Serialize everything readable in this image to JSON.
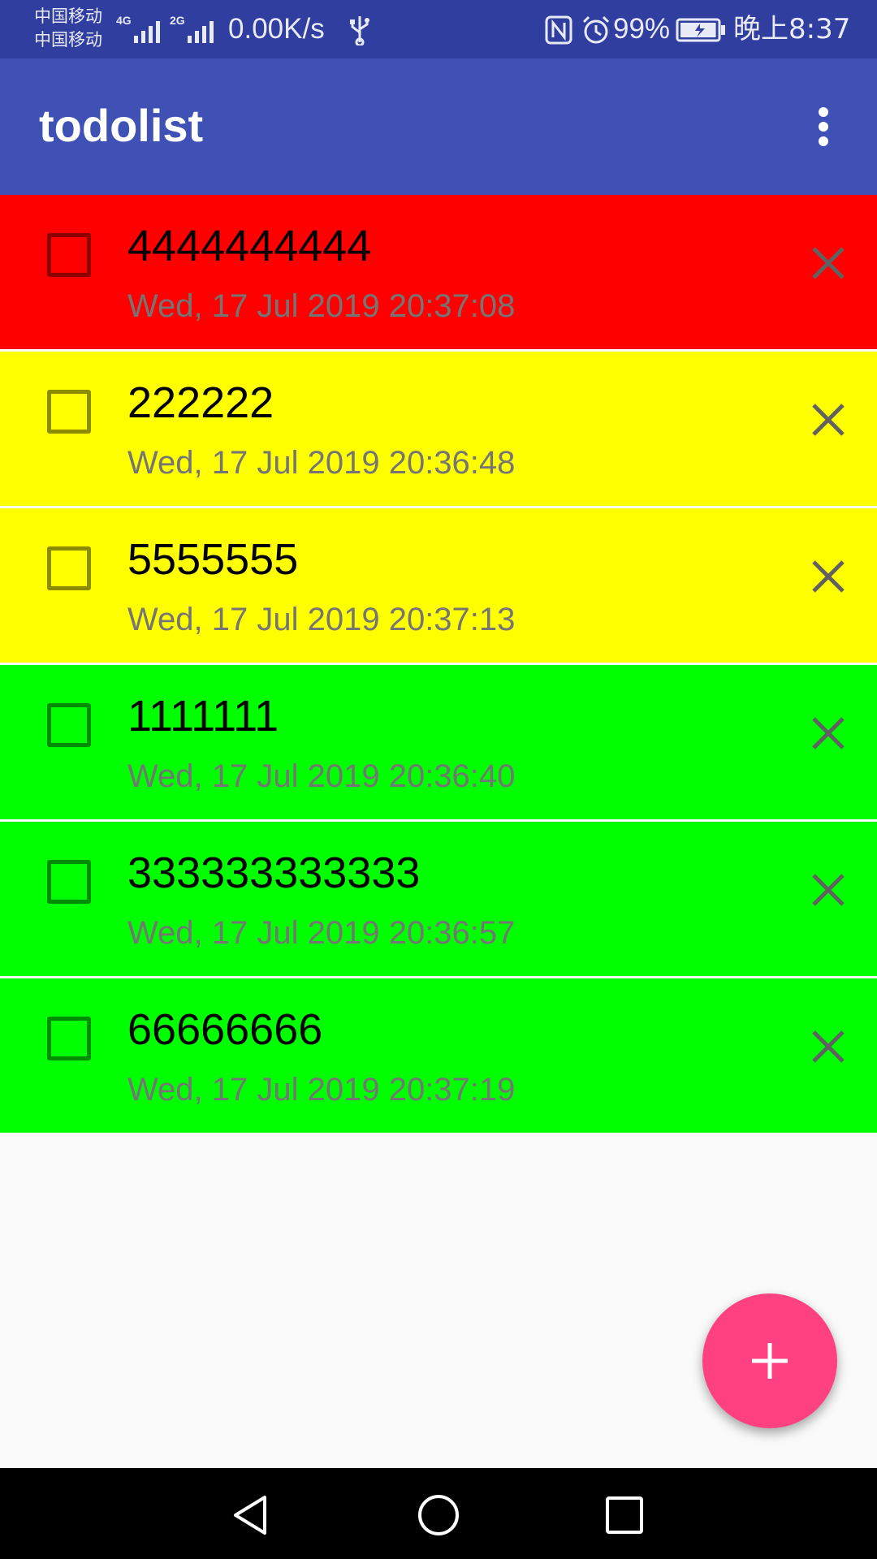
{
  "status_bar": {
    "carrier_line1": "中国移动",
    "carrier_line2": "中国移动",
    "sim1_network": "4G",
    "sim2_network": "2G",
    "net_speed": "0.00K/s",
    "battery_percent": "99%",
    "battery_level": 0.99,
    "time": "晚上8:37",
    "icons": [
      "signal-icon",
      "usb-icon",
      "nfc-icon",
      "alarm-icon",
      "battery-icon"
    ]
  },
  "app_bar": {
    "title": "todolist",
    "menu_icon": "more-vert-icon"
  },
  "colors": {
    "status_bar": "#303f9f",
    "app_bar": "#3f51b5",
    "fab": "#ff4081",
    "priority_high": "#ff0000",
    "priority_medium": "#ffff00",
    "priority_low": "#00ff00"
  },
  "todos": [
    {
      "text": "4444444444",
      "date": "Wed, 17 Jul 2019 20:37:08",
      "priority": "high",
      "color": "#ff0000",
      "checked": false
    },
    {
      "text": "222222",
      "date": "Wed, 17 Jul 2019 20:36:48",
      "priority": "medium",
      "color": "#ffff00",
      "checked": false
    },
    {
      "text": "5555555",
      "date": "Wed, 17 Jul 2019 20:37:13",
      "priority": "medium",
      "color": "#ffff00",
      "checked": false
    },
    {
      "text": "1111111",
      "date": "Wed, 17 Jul 2019 20:36:40",
      "priority": "low",
      "color": "#00ff00",
      "checked": false
    },
    {
      "text": "333333333333",
      "date": "Wed, 17 Jul 2019 20:36:57",
      "priority": "low",
      "color": "#00ff00",
      "checked": false
    },
    {
      "text": "66666666",
      "date": "Wed, 17 Jul 2019 20:37:19",
      "priority": "low",
      "color": "#00ff00",
      "checked": false
    }
  ],
  "fab": {
    "icon": "plus-icon"
  },
  "nav_bar": {
    "buttons": [
      "back-icon",
      "home-icon",
      "recents-icon"
    ]
  }
}
